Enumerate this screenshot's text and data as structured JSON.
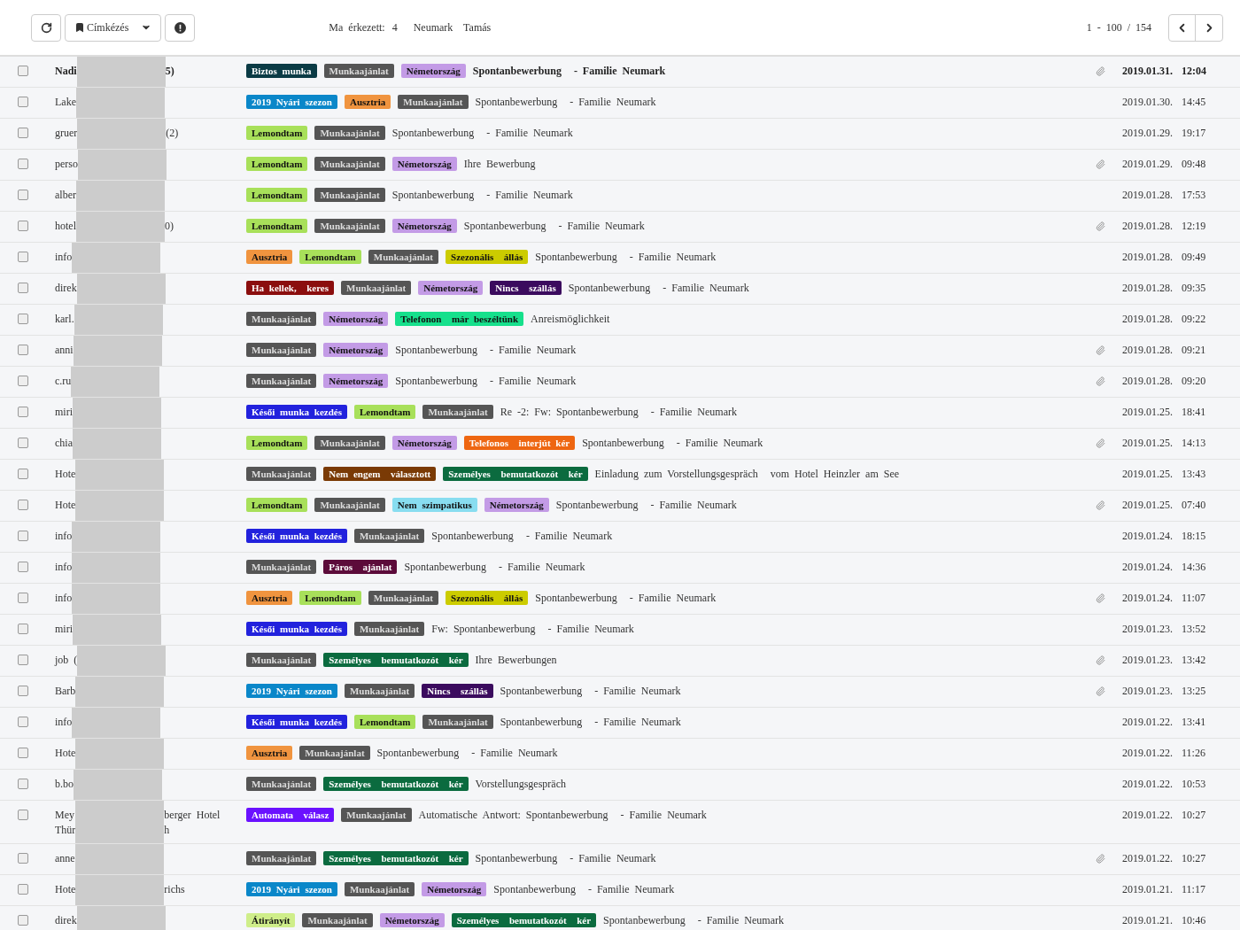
{
  "toolbar": {
    "label_button": "Címkézés",
    "arrived_label": "Ma érkezett:",
    "arrived_count": "4",
    "user": "Neumark  Tamás",
    "pagination": "1 - 100 / 154"
  },
  "rows": [
    {
      "checked": false,
      "unread": true,
      "sender": [
        {
          "head": "Nadi",
          "tail": "5)"
        }
      ],
      "tags": [
        {
          "label": "Biztos munka",
          "color": "#0b3b45"
        },
        {
          "label": "Munkaajánlat",
          "color": "#555555"
        },
        {
          "label": "Németország",
          "color": "#c39be6"
        }
      ],
      "subject": "Spontanbewerbung",
      "preview": "- Familie Neumark",
      "attachment": true,
      "date": "2019.01.31.",
      "time": "12:04"
    },
    {
      "checked": false,
      "unread": false,
      "sender": [
        {
          "head": "Lake"
        }
      ],
      "tags": [
        {
          "label": "2019 Nyári szezon",
          "color": "#0a87c9"
        },
        {
          "label": "Ausztria",
          "color": "#f0943f"
        },
        {
          "label": "Munkaajánlat",
          "color": "#555555"
        }
      ],
      "subject": "Spontanbewerbung",
      "preview": "- Familie Neumark",
      "attachment": false,
      "date": "2019.01.30.",
      "time": "14:45"
    },
    {
      "checked": false,
      "unread": false,
      "sender": [
        {
          "head": "gruer",
          "tail": "(2)"
        }
      ],
      "tags": [
        {
          "label": "Lemondtam",
          "color": "#a8e05a"
        },
        {
          "label": "Munkaajánlat",
          "color": "#555555"
        }
      ],
      "subject": "Spontanbewerbung",
      "preview": "- Familie Neumark",
      "attachment": false,
      "date": "2019.01.29.",
      "time": "19:17"
    },
    {
      "checked": false,
      "unread": false,
      "sender": [
        {
          "head": "perso"
        }
      ],
      "tags": [
        {
          "label": "Lemondtam",
          "color": "#a8e05a"
        },
        {
          "label": "Munkaajánlat",
          "color": "#555555"
        },
        {
          "label": "Németország",
          "color": "#c39be6"
        }
      ],
      "subject": "Ihre Bewerbung",
      "attachment": true,
      "date": "2019.01.29.",
      "time": "09:48"
    },
    {
      "checked": false,
      "unread": false,
      "sender": [
        {
          "head": "alber"
        }
      ],
      "tags": [
        {
          "label": "Lemondtam",
          "color": "#a8e05a"
        },
        {
          "label": "Munkaajánlat",
          "color": "#555555"
        }
      ],
      "subject": "Spontanbewerbung",
      "preview": "- Familie Neumark",
      "attachment": false,
      "date": "2019.01.28.",
      "time": "17:53"
    },
    {
      "checked": false,
      "unread": false,
      "sender": [
        {
          "head": "hotel",
          "tail": "0)"
        }
      ],
      "tags": [
        {
          "label": "Lemondtam",
          "color": "#a8e05a"
        },
        {
          "label": "Munkaajánlat",
          "color": "#555555"
        },
        {
          "label": "Németország",
          "color": "#c39be6"
        }
      ],
      "subject": "Spontanbewerbung",
      "preview": "- Familie Neumark",
      "attachment": true,
      "date": "2019.01.28.",
      "time": "12:19"
    },
    {
      "checked": false,
      "unread": false,
      "sender": [
        {
          "head": "info"
        }
      ],
      "tags": [
        {
          "label": "Ausztria",
          "color": "#f0943f"
        },
        {
          "label": "Lemondtam",
          "color": "#a8e05a"
        },
        {
          "label": "Munkaajánlat",
          "color": "#555555"
        },
        {
          "label": "Szezonális  állás",
          "color": "#cccc00"
        }
      ],
      "subject": "Spontanbewerbung",
      "preview": "- Familie Neumark",
      "attachment": false,
      "date": "2019.01.28.",
      "time": "09:49"
    },
    {
      "checked": false,
      "unread": false,
      "sender": [
        {
          "head": "direk"
        }
      ],
      "tags": [
        {
          "label": "Ha kellek,  keres",
          "color": "#8b0e0e"
        },
        {
          "label": "Munkaajánlat",
          "color": "#555555"
        },
        {
          "label": "Németország",
          "color": "#c39be6"
        },
        {
          "label": "Nincs  szállás",
          "color": "#3b0b5e"
        }
      ],
      "subject": "Spontanbewerbung",
      "preview": "- Familie Neumark",
      "attachment": false,
      "date": "2019.01.28.",
      "time": "09:35"
    },
    {
      "checked": false,
      "unread": false,
      "sender": [
        {
          "head": "karl."
        }
      ],
      "tags": [
        {
          "label": "Munkaajánlat",
          "color": "#555555"
        },
        {
          "label": "Németország",
          "color": "#c39be6"
        },
        {
          "label": "Telefonon  már beszéltünk",
          "color": "#16e08c"
        }
      ],
      "subject": "Anreismöglichkeit",
      "attachment": false,
      "date": "2019.01.28.",
      "time": "09:22"
    },
    {
      "checked": false,
      "unread": false,
      "sender": [
        {
          "head": "anni"
        }
      ],
      "tags": [
        {
          "label": "Munkaajánlat",
          "color": "#555555"
        },
        {
          "label": "Németország",
          "color": "#c39be6"
        }
      ],
      "subject": "Spontanbewerbung",
      "preview": "- Familie Neumark",
      "attachment": true,
      "date": "2019.01.28.",
      "time": "09:21"
    },
    {
      "checked": false,
      "unread": false,
      "sender": [
        {
          "head": "c.ru"
        }
      ],
      "tags": [
        {
          "label": "Munkaajánlat",
          "color": "#555555"
        },
        {
          "label": "Németország",
          "color": "#c39be6"
        }
      ],
      "subject": "Spontanbewerbung",
      "preview": "- Familie Neumark",
      "attachment": true,
      "date": "2019.01.28.",
      "time": "09:20"
    },
    {
      "checked": false,
      "unread": false,
      "sender": [
        {
          "head": "miri"
        }
      ],
      "tags": [
        {
          "label": "Késői munka kezdés",
          "color": "#2222dd"
        },
        {
          "label": "Lemondtam",
          "color": "#a8e05a"
        },
        {
          "label": "Munkaajánlat",
          "color": "#555555"
        }
      ],
      "subject": "Re -2: Fw: Spontanbewerbung",
      "preview": "- Familie Neumark",
      "attachment": false,
      "date": "2019.01.25.",
      "time": "18:41"
    },
    {
      "checked": false,
      "unread": false,
      "sender": [
        {
          "head": "chia"
        }
      ],
      "tags": [
        {
          "label": "Lemondtam",
          "color": "#a8e05a"
        },
        {
          "label": "Munkaajánlat",
          "color": "#555555"
        },
        {
          "label": "Németország",
          "color": "#c39be6"
        },
        {
          "label": "Telefonos  interjút kér",
          "color": "#ee6611"
        }
      ],
      "subject": "Spontanbewerbung",
      "preview": "- Familie Neumark",
      "attachment": true,
      "date": "2019.01.25.",
      "time": "14:13"
    },
    {
      "checked": false,
      "unread": false,
      "sender": [
        {
          "head": "Hote"
        }
      ],
      "tags": [
        {
          "label": "Munkaajánlat",
          "color": "#555555"
        },
        {
          "label": "Nem engem  választott",
          "color": "#7a3a05"
        },
        {
          "label": "Személyes  bemutatkozót  kér",
          "color": "#0b6b3f"
        }
      ],
      "subject": "Einladung zum Vorstellungsgespräch",
      "preview": "vom Hotel Heinzler am See",
      "attachment": false,
      "date": "2019.01.25.",
      "time": "13:43"
    },
    {
      "checked": false,
      "unread": false,
      "sender": [
        {
          "head": "Hote"
        }
      ],
      "tags": [
        {
          "label": "Lemondtam",
          "color": "#a8e05a"
        },
        {
          "label": "Munkaajánlat",
          "color": "#555555"
        },
        {
          "label": "Nem szimpatikus",
          "color": "#88ddf0"
        },
        {
          "label": "Németország",
          "color": "#c39be6"
        }
      ],
      "subject": "Spontanbewerbung",
      "preview": "- Familie Neumark",
      "attachment": true,
      "date": "2019.01.25.",
      "time": "07:40"
    },
    {
      "checked": false,
      "unread": false,
      "sender": [
        {
          "head": "info"
        }
      ],
      "tags": [
        {
          "label": "Késői munka kezdés",
          "color": "#2222dd"
        },
        {
          "label": "Munkaajánlat",
          "color": "#555555"
        }
      ],
      "subject": "Spontanbewerbung",
      "preview": "- Familie Neumark",
      "attachment": false,
      "date": "2019.01.24.",
      "time": "18:15"
    },
    {
      "checked": false,
      "unread": false,
      "sender": [
        {
          "head": "info"
        }
      ],
      "tags": [
        {
          "label": "Munkaajánlat",
          "color": "#555555"
        },
        {
          "label": "Páros  ajánlat",
          "color": "#5c0b3a"
        }
      ],
      "subject": "Spontanbewerbung",
      "preview": "- Familie Neumark",
      "attachment": false,
      "date": "2019.01.24.",
      "time": "14:36"
    },
    {
      "checked": false,
      "unread": false,
      "sender": [
        {
          "head": "info"
        }
      ],
      "tags": [
        {
          "label": "Ausztria",
          "color": "#f0943f"
        },
        {
          "label": "Lemondtam",
          "color": "#a8e05a"
        },
        {
          "label": "Munkaajánlat",
          "color": "#555555"
        },
        {
          "label": "Szezonális  állás",
          "color": "#cccc00"
        }
      ],
      "subject": "Spontanbewerbung",
      "preview": "- Familie Neumark",
      "attachment": true,
      "date": "2019.01.24.",
      "time": "11:07"
    },
    {
      "checked": false,
      "unread": false,
      "sender": [
        {
          "head": "miri"
        }
      ],
      "tags": [
        {
          "label": "Késői munka kezdés",
          "color": "#2222dd"
        },
        {
          "label": "Munkaajánlat",
          "color": "#555555"
        }
      ],
      "subject": "Fw: Spontanbewerbung",
      "preview": "- Familie Neumark",
      "attachment": false,
      "date": "2019.01.23.",
      "time": "13:52"
    },
    {
      "checked": false,
      "unread": false,
      "sender": [
        {
          "head": "job ("
        }
      ],
      "tags": [
        {
          "label": "Munkaajánlat",
          "color": "#555555"
        },
        {
          "label": "Személyes  bemutatkozót  kér",
          "color": "#0b6b3f"
        }
      ],
      "subject": "Ihre Bewerbungen",
      "attachment": true,
      "date": "2019.01.23.",
      "time": "13:42"
    },
    {
      "checked": false,
      "unread": false,
      "sender": [
        {
          "head": "Barb"
        }
      ],
      "tags": [
        {
          "label": "2019 Nyári szezon",
          "color": "#0a87c9"
        },
        {
          "label": "Munkaajánlat",
          "color": "#555555"
        },
        {
          "label": "Nincs  szállás",
          "color": "#3b0b5e"
        }
      ],
      "subject": "Spontanbewerbung",
      "preview": "- Familie Neumark",
      "attachment": true,
      "date": "2019.01.23.",
      "time": "13:25"
    },
    {
      "checked": false,
      "unread": false,
      "sender": [
        {
          "head": "info"
        }
      ],
      "tags": [
        {
          "label": "Késői munka kezdés",
          "color": "#2222dd"
        },
        {
          "label": "Lemondtam",
          "color": "#a8e05a"
        },
        {
          "label": "Munkaajánlat",
          "color": "#555555"
        }
      ],
      "subject": "Spontanbewerbung",
      "preview": "- Familie Neumark",
      "attachment": false,
      "date": "2019.01.22.",
      "time": "13:41"
    },
    {
      "checked": false,
      "unread": false,
      "sender": [
        {
          "head": "Hote"
        }
      ],
      "tags": [
        {
          "label": "Ausztria",
          "color": "#f0943f"
        },
        {
          "label": "Munkaajánlat",
          "color": "#555555"
        }
      ],
      "subject": "Spontanbewerbung",
      "preview": "- Familie Neumark",
      "attachment": false,
      "date": "2019.01.22.",
      "time": "11:26"
    },
    {
      "checked": false,
      "unread": false,
      "sender": [
        {
          "head": "b.bo"
        }
      ],
      "tags": [
        {
          "label": "Munkaajánlat",
          "color": "#555555"
        },
        {
          "label": "Személyes  bemutatkozót  kér",
          "color": "#0b6b3f"
        }
      ],
      "subject": "Vorstellungsgespräch",
      "attachment": false,
      "date": "2019.01.22.",
      "time": "10:53"
    },
    {
      "checked": false,
      "unread": false,
      "sender": [
        {
          "head": "Mey",
          "tail": "berger Hotel"
        },
        {
          "head": "Thür",
          "tail": "h"
        }
      ],
      "tags": [
        {
          "label": "Automata  válasz",
          "color": "#6a11ff"
        },
        {
          "label": "Munkaajánlat",
          "color": "#555555"
        }
      ],
      "subject": "Automatische Antwort: Spontanbewerbung",
      "preview": "- Familie Neumark",
      "attachment": false,
      "date": "2019.01.22.",
      "time": "10:27"
    },
    {
      "checked": false,
      "unread": false,
      "sender": [
        {
          "head": "anne"
        }
      ],
      "tags": [
        {
          "label": "Munkaajánlat",
          "color": "#555555"
        },
        {
          "label": "Személyes  bemutatkozót  kér",
          "color": "#0b6b3f"
        }
      ],
      "subject": "Spontanbewerbung",
      "preview": "- Familie Neumark",
      "attachment": true,
      "date": "2019.01.22.",
      "time": "10:27"
    },
    {
      "checked": false,
      "unread": false,
      "sender": [
        {
          "head": "Hote",
          "tail": "richs"
        }
      ],
      "tags": [
        {
          "label": "2019 Nyári szezon",
          "color": "#0a87c9"
        },
        {
          "label": "Munkaajánlat",
          "color": "#555555"
        },
        {
          "label": "Németország",
          "color": "#c39be6"
        }
      ],
      "subject": "Spontanbewerbung",
      "preview": "- Familie Neumark",
      "attachment": false,
      "date": "2019.01.21.",
      "time": "11:17"
    },
    {
      "checked": false,
      "unread": false,
      "sender": [
        {
          "head": "direk"
        }
      ],
      "tags": [
        {
          "label": "Átirányít",
          "color": "#cfee8a"
        },
        {
          "label": "Munkaajánlat",
          "color": "#555555"
        },
        {
          "label": "Németország",
          "color": "#c39be6"
        },
        {
          "label": "Személyes  bemutatkozót  kér",
          "color": "#0b6b3f"
        }
      ],
      "subject": "Spontanbewerbung",
      "preview": "- Familie Neumark",
      "attachment": false,
      "date": "2019.01.21.",
      "time": "10:46"
    }
  ]
}
